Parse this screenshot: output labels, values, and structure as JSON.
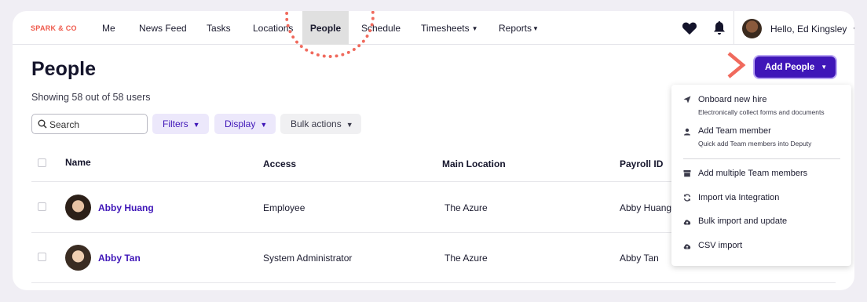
{
  "nav": {
    "logo": "SPARK & CO",
    "items": [
      {
        "label": "Me"
      },
      {
        "label": "News Feed"
      },
      {
        "label": "Tasks"
      },
      {
        "label": "Locations"
      },
      {
        "label": "People"
      },
      {
        "label": "Schedule"
      },
      {
        "label": "Timesheets"
      },
      {
        "label": "Reports"
      }
    ],
    "active": "People",
    "user_greeting": "Hello, Ed Kingsley"
  },
  "page": {
    "title": "People",
    "showing": "Showing 58 out of 58 users",
    "add_button": "Add People"
  },
  "toolbar": {
    "search_placeholder": "Search",
    "filters": "Filters",
    "display": "Display",
    "bulk_actions": "Bulk actions"
  },
  "table": {
    "columns": [
      "Name",
      "Access",
      "Main Location",
      "Payroll ID"
    ],
    "rows": [
      {
        "name": "Abby Huang",
        "access": "Employee",
        "location": "The Azure",
        "payroll_id": "Abby Huang"
      },
      {
        "name": "Abby Tan",
        "access": "System Administrator",
        "location": "The Azure",
        "payroll_id": "Abby Tan"
      }
    ]
  },
  "add_menu": {
    "items": [
      {
        "label": "Onboard new hire",
        "sub": "Electronically collect forms and documents",
        "icon": "send-icon"
      },
      {
        "label": "Add Team member",
        "sub": "Quick add Team members into Deputy",
        "icon": "person-icon"
      },
      {
        "label": "Add multiple Team members",
        "icon": "store-icon"
      },
      {
        "label": "Import via Integration",
        "icon": "sync-icon"
      },
      {
        "label": "Bulk import and update",
        "icon": "cloud-upload-icon"
      },
      {
        "label": "CSV import",
        "icon": "cloud-upload-icon"
      }
    ]
  },
  "colors": {
    "brand": "#3f16b8",
    "logo": "#ef5a4c",
    "highlight_dots": "#f06a5d"
  }
}
